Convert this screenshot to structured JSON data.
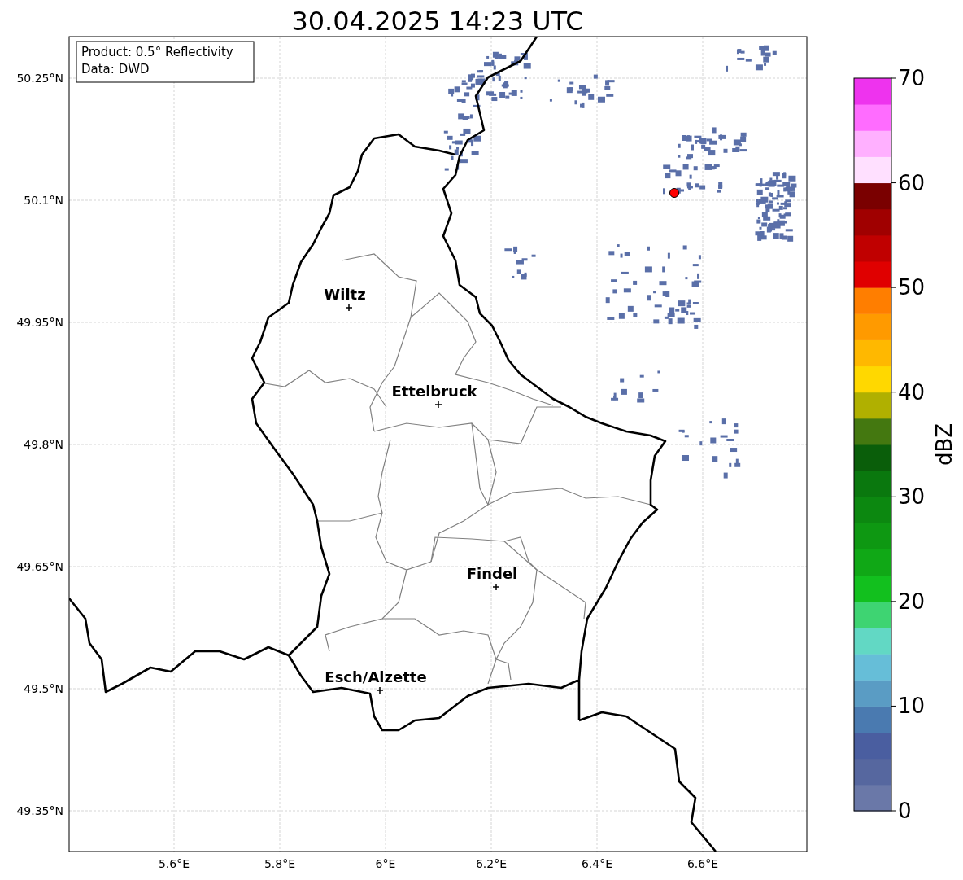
{
  "title": "30.04.2025 14:23 UTC",
  "legend": [
    "Product: 0.5° Reflectivity",
    "Data: DWD"
  ],
  "map": {
    "lat_labels": [
      "50.25°N",
      "50.1°N",
      "49.95°N",
      "49.8°N",
      "49.65°N",
      "49.5°N",
      "49.35°N"
    ],
    "lon_labels": [
      "5.6°E",
      "5.8°E",
      "6°E",
      "6.2°E",
      "6.4°E",
      "6.6°E"
    ],
    "cities": [
      {
        "name": "Wiltz"
      },
      {
        "name": "Ettelbruck"
      },
      {
        "name": "Findel"
      },
      {
        "name": "Esch/Alzette"
      }
    ]
  },
  "colorbar": {
    "label": "dBZ",
    "ticks": [
      "70",
      "60",
      "50",
      "40",
      "30",
      "20",
      "10",
      "0"
    ]
  }
}
